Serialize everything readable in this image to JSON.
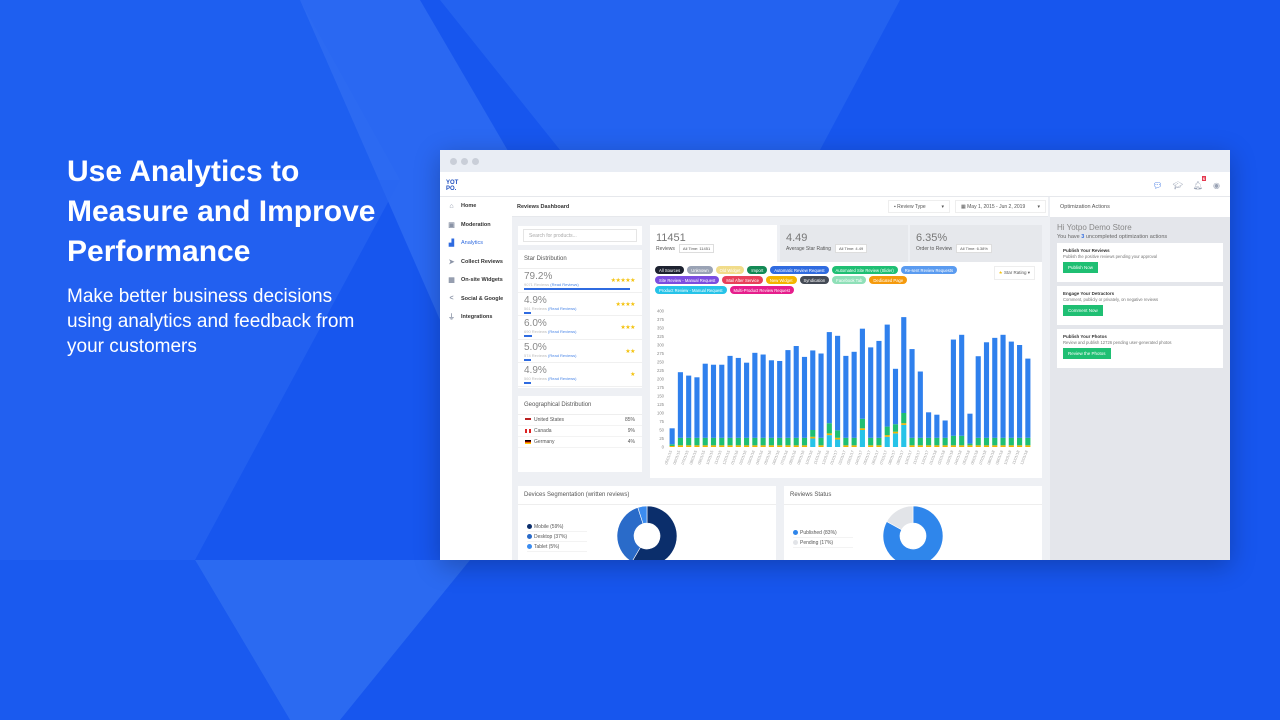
{
  "hero": {
    "title": "Use Analytics to Measure and Improve Performance",
    "subtitle": "Make better business decisions using analytics and feedback from your customers"
  },
  "colors": {
    "background": "#1756ee",
    "accent": "#2f6be0",
    "success": "#1fbf73"
  },
  "app": {
    "logo": "YOT PO.",
    "header_icons": [
      "chat-icon",
      "graduation-cap-icon",
      "bell-icon",
      "user-icon"
    ],
    "notification_count": "6"
  },
  "sidebar": {
    "items": [
      {
        "label": "Home",
        "icon": "home-icon"
      },
      {
        "label": "Moderation",
        "icon": "folder-icon"
      },
      {
        "label": "Analytics",
        "icon": "bar-chart-icon",
        "active": true
      },
      {
        "label": "Collect Reviews",
        "icon": "send-icon"
      },
      {
        "label": "On-site Widgets",
        "icon": "grid-icon"
      },
      {
        "label": "Social & Google",
        "icon": "share-icon"
      },
      {
        "label": "Integrations",
        "icon": "plug-icon"
      }
    ]
  },
  "dashboard": {
    "title": "Reviews Dashboard",
    "review_type": "Review Type",
    "date_range": "May 1, 2015 - Jun 2, 2019",
    "search_placeholder": "Search for products..."
  },
  "star_distribution": {
    "title": "Star Distribution",
    "read_label": "(Read Reviews)",
    "rows": [
      {
        "pct": "79.2%",
        "count": "9071 Reviews",
        "stars": "★★★★★",
        "share": 79.2
      },
      {
        "pct": "4.9%",
        "count": "561 Reviews",
        "stars": "★★★★",
        "share": 4.9
      },
      {
        "pct": "6.0%",
        "count": "690 Reviews",
        "stars": "★★★",
        "share": 6.0
      },
      {
        "pct": "5.0%",
        "count": "574 Reviews",
        "stars": "★★",
        "share": 5.0
      },
      {
        "pct": "4.9%",
        "count": "560 Reviews",
        "stars": "★",
        "share": 4.9
      }
    ]
  },
  "geo": {
    "title": "Geographical Distribution",
    "rows": [
      {
        "country": "United States",
        "pct": "85%"
      },
      {
        "country": "Canada",
        "pct": "9%"
      },
      {
        "country": "Germany",
        "pct": "4%"
      }
    ]
  },
  "stats": [
    {
      "value": "11451",
      "label": "Reviews",
      "all_time": "All Time: 11451"
    },
    {
      "value": "4.49",
      "label": "Average Star Rating",
      "all_time": "All Time: 4.49"
    },
    {
      "value": "6.35%",
      "label": "Order to Review",
      "all_time": "All Time: 6.38%"
    }
  ],
  "source_tags": [
    {
      "label": "All Sources",
      "color": "#1d2230"
    },
    {
      "label": "Unknown",
      "color": "#9aa3b5"
    },
    {
      "label": "Old Widget",
      "color": "#f1dc8a"
    },
    {
      "label": "Import",
      "color": "#138a55"
    },
    {
      "label": "Automatic Review Request",
      "color": "#2f6be0"
    },
    {
      "label": "Automated Site Review (Slider)",
      "color": "#1fbf73"
    },
    {
      "label": "Re-sent Review Requests",
      "color": "#5a9bf0"
    },
    {
      "label": "Site Review - Manual Request",
      "color": "#7b4de0"
    },
    {
      "label": "Mail After Service",
      "color": "#e8405a"
    },
    {
      "label": "New Widget",
      "color": "#f4b400"
    },
    {
      "label": "Syndication",
      "color": "#444a55"
    },
    {
      "label": "Facebook Tab",
      "color": "#8fe0b8"
    },
    {
      "label": "Dedicated Page",
      "color": "#f59a0c"
    },
    {
      "label": "Product Review - Manual Request",
      "color": "#26c3e8"
    },
    {
      "label": "Multi-Product Review Request",
      "color": "#e61e8c"
    }
  ],
  "star_rating_filter": "Star Rating",
  "chart_data": [
    {
      "type": "bar",
      "stacked": true,
      "ylim": [
        0,
        400
      ],
      "yticks": [
        0,
        25,
        50,
        75,
        100,
        125,
        150,
        175,
        200,
        225,
        250,
        275,
        300,
        325,
        350,
        375,
        400
      ],
      "grid": false,
      "categories": [
        "05/01/15",
        "06/01/15",
        "07/01/15",
        "08/01/15",
        "09/01/15",
        "10/01/15",
        "11/01/15",
        "12/01/15",
        "01/01/16",
        "02/01/16",
        "03/01/16",
        "04/01/16",
        "05/01/16",
        "06/01/16",
        "07/01/16",
        "08/01/16",
        "09/01/16",
        "10/01/16",
        "11/01/16",
        "12/01/16",
        "01/01/17",
        "02/01/17",
        "03/01/17",
        "04/01/17",
        "05/01/17",
        "06/01/17",
        "07/01/17",
        "08/01/17",
        "09/01/17",
        "10/01/17",
        "11/01/17",
        "12/01/17",
        "01/01/18",
        "02/01/18",
        "03/01/18",
        "04/01/18",
        "05/01/18",
        "06/01/18",
        "07/01/18",
        "08/01/18",
        "09/01/18",
        "10/01/18",
        "11/01/18",
        "12/01/18"
      ],
      "series": [
        {
          "color": "#26c3e8",
          "values": [
            0,
            0,
            0,
            0,
            0,
            0,
            0,
            0,
            0,
            0,
            0,
            0,
            0,
            0,
            0,
            0,
            0,
            25,
            0,
            35,
            22,
            0,
            0,
            50,
            0,
            0,
            30,
            40,
            65,
            0,
            0,
            0,
            0,
            0,
            0,
            0,
            0,
            0,
            0,
            0,
            0,
            0,
            0,
            0
          ]
        },
        {
          "color": "#f4b400",
          "values": [
            3,
            5,
            5,
            5,
            5,
            5,
            5,
            5,
            5,
            5,
            5,
            5,
            5,
            5,
            5,
            5,
            5,
            5,
            5,
            5,
            5,
            5,
            5,
            5,
            5,
            5,
            5,
            5,
            5,
            5,
            5,
            5,
            5,
            5,
            5,
            5,
            5,
            5,
            5,
            5,
            5,
            5,
            5,
            5
          ]
        },
        {
          "color": "#1fbf73",
          "values": [
            5,
            22,
            22,
            22,
            22,
            22,
            22,
            22,
            22,
            22,
            22,
            22,
            22,
            22,
            22,
            22,
            22,
            20,
            22,
            30,
            22,
            22,
            22,
            28,
            22,
            22,
            25,
            22,
            30,
            22,
            22,
            22,
            22,
            22,
            28,
            28,
            5,
            22,
            22,
            22,
            22,
            22,
            22,
            22
          ]
        },
        {
          "color": "#2f80ed",
          "values": [
            47,
            193,
            183,
            178,
            218,
            215,
            215,
            241,
            235,
            221,
            250,
            245,
            228,
            226,
            258,
            270,
            238,
            234,
            248,
            268,
            278,
            241,
            253,
            265,
            266,
            285,
            300,
            163,
            282,
            261,
            195,
            75,
            68,
            51,
            283,
            297,
            88,
            240,
            281,
            294,
            303,
            283,
            273,
            233
          ]
        }
      ]
    },
    {
      "type": "pie",
      "title": "Devices Segmentation (written reviews)",
      "categories": [
        "Mobile (59%)",
        "Desktop (37%)",
        "Tablet (5%)"
      ],
      "values": [
        59,
        37,
        5
      ],
      "colors": [
        "#0b2e6b",
        "#2a6bc9",
        "#3b8cf0"
      ],
      "legend": "left"
    },
    {
      "type": "pie",
      "title": "Reviews Status",
      "categories": [
        "Published (83%)",
        "Pending (17%)"
      ],
      "values": [
        83,
        17
      ],
      "colors": [
        "#2f86eb",
        "#e2e4e8"
      ],
      "legend": "left"
    }
  ],
  "optimization": {
    "title": "Optimization Actions",
    "greeting": "Hi Yotpo Demo Store",
    "count_prefix": "You have ",
    "count": "3",
    "count_suffix": " uncompleted optimization actions",
    "actions": [
      {
        "title": "Publish Your Reviews",
        "desc": "Publish the positive reviews pending your approval",
        "button": "Publish Now"
      },
      {
        "title": "Engage Your Detractors",
        "desc": "Comment, publicly or privately, on negative reviews",
        "button": "Comment Now"
      },
      {
        "title": "Publish Your Photos",
        "desc": "Review and publish 12726 pending user-generated photos",
        "button": "Review the Photos"
      }
    ]
  }
}
